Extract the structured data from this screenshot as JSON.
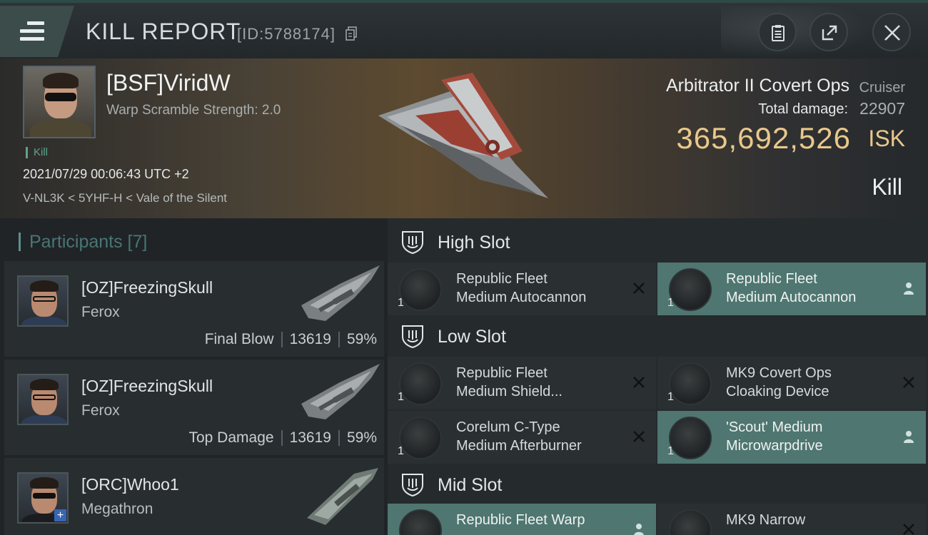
{
  "header": {
    "title": "KILL REPORT",
    "report_id": "[ID:5788174]"
  },
  "victim": {
    "name": "[BSF]ViridW",
    "warp_scramble": "Warp Scramble Strength: 2.0",
    "tag": "Kill",
    "datetime": "2021/07/29 00:06:43 UTC +2",
    "location": "V-NL3K < 5YHF-H < Vale of the Silent",
    "ship_name": "Arbitrator II Covert Ops",
    "ship_class": "Cruiser",
    "total_damage_label": "Total damage:",
    "total_damage": "22907",
    "isk_value": "365,692,526",
    "isk_unit": "ISK",
    "result": "Kill"
  },
  "participants": {
    "header": "Participants [7]",
    "rows": [
      {
        "name": "[OZ]FreezingSkull",
        "ship": "Ferox",
        "role": "Final Blow",
        "damage": "13619",
        "percent": "59%"
      },
      {
        "name": "[OZ]FreezingSkull",
        "ship": "Ferox",
        "role": "Top Damage",
        "damage": "13619",
        "percent": "59%"
      },
      {
        "name": "[ORC]Whoo1",
        "ship": "Megathron",
        "role": "",
        "damage": "",
        "percent": ""
      }
    ]
  },
  "fitting": {
    "high_slot": {
      "label": "High Slot",
      "modules": [
        {
          "line1": "Republic Fleet",
          "line2": "Medium Autocannon",
          "qty": "1",
          "status": "destroyed"
        },
        {
          "line1": "Republic Fleet",
          "line2": "Medium Autocannon",
          "qty": "1",
          "status": "dropped"
        }
      ]
    },
    "low_slot": {
      "label": "Low Slot",
      "modules": [
        {
          "line1": "Republic Fleet",
          "line2": "Medium Shield...",
          "qty": "1",
          "status": "destroyed"
        },
        {
          "line1": "MK9 Covert Ops",
          "line2": "Cloaking Device",
          "qty": "1",
          "status": "destroyed"
        },
        {
          "line1": "Corelum C-Type",
          "line2": "Medium Afterburner",
          "qty": "1",
          "status": "destroyed"
        },
        {
          "line1": "'Scout' Medium",
          "line2": "Microwarpdrive",
          "qty": "1",
          "status": "dropped"
        }
      ]
    },
    "mid_slot": {
      "label": "Mid Slot",
      "modules": [
        {
          "line1": "Republic Fleet Warp",
          "line2": "",
          "qty": "",
          "status": "dropped"
        },
        {
          "line1": "MK9 Narrow",
          "line2": "",
          "qty": "",
          "status": "destroyed"
        }
      ]
    }
  },
  "colors": {
    "accent_teal": "#4f7670",
    "isk_gold": "#e9c88a",
    "background": "#1b1f22"
  },
  "icons": [
    "menu-icon",
    "copy-icon",
    "report-icon",
    "share-icon",
    "close-icon",
    "slot-shield-icon",
    "destroyed-x-icon",
    "dropped-person-icon"
  ]
}
